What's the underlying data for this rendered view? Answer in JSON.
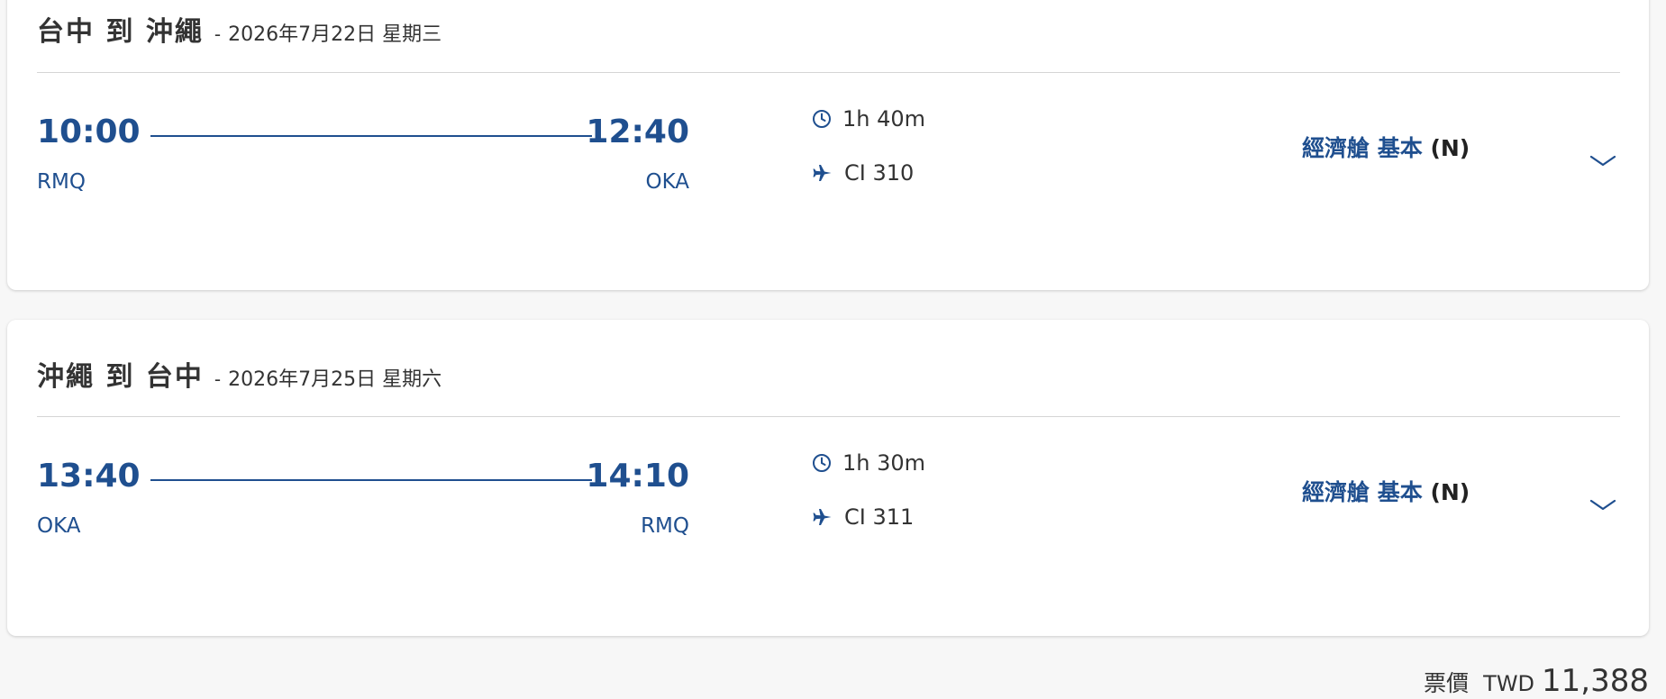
{
  "segments": [
    {
      "route": "台中 到 沖繩",
      "separator": "-",
      "date": "2026年7月22日 星期三",
      "depart_time": "10:00",
      "arrive_time": "12:40",
      "depart_code": "RMQ",
      "arrive_code": "OKA",
      "duration": "1h 40m",
      "flight_no": "CI 310",
      "cabin": "經濟艙 基本",
      "fare_class": "(N)"
    },
    {
      "route": "沖繩 到 台中",
      "separator": "-",
      "date": "2026年7月25日 星期六",
      "depart_time": "13:40",
      "arrive_time": "14:10",
      "depart_code": "OKA",
      "arrive_code": "RMQ",
      "duration": "1h 30m",
      "flight_no": "CI 311",
      "cabin": "經濟艙 基本",
      "fare_class": "(N)"
    }
  ],
  "price": {
    "label": "票價",
    "currency": "TWD",
    "amount": "11,388"
  },
  "icons": {
    "duration": "clock-icon",
    "flight": "airplane-icon",
    "expand": "chevron-down-icon"
  },
  "colors": {
    "accent": "#1f4f8f",
    "text": "#333333",
    "background": "#f7f7f7"
  }
}
